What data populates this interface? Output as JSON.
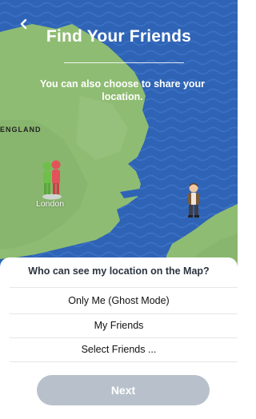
{
  "header": {
    "back_icon": "chevron-left-icon",
    "title": "Find Your Friends",
    "subtitle": "You can also choose to share your location."
  },
  "map": {
    "region_label": "ENGLAND",
    "city_label": "London",
    "sea_color": "#2f63b5",
    "land_color": "#8fbc73"
  },
  "sheet": {
    "question": "Who can see my location on the Map?",
    "options": [
      {
        "label": "Only Me (Ghost Mode)"
      },
      {
        "label": "My Friends"
      },
      {
        "label": "Select Friends ..."
      }
    ],
    "next_label": "Next",
    "next_color": "#b8c1cb"
  }
}
